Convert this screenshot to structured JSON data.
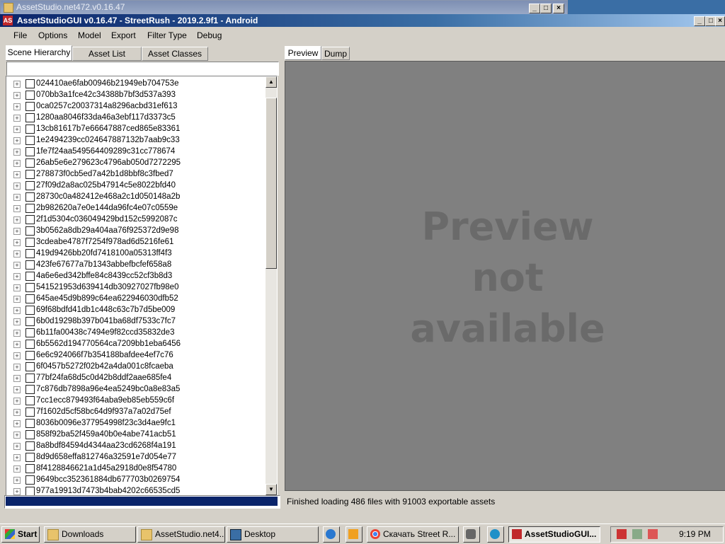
{
  "background_window": {
    "title": "AssetStudio.net472.v0.16.47"
  },
  "window": {
    "title": "AssetStudioGUI v0.16.47 - StreetRush - 2019.2.9f1 - Android",
    "logo": "AS"
  },
  "menu": [
    "File",
    "Options",
    "Model",
    "Export",
    "Filter Type",
    "Debug"
  ],
  "left_tabs": [
    "Scene Hierarchy",
    "Asset List",
    "Asset Classes"
  ],
  "search": {
    "value": ""
  },
  "tree_items": [
    "024410ae6fab00946b21949eb704753e",
    "070bb3a1fce42c34388b7bf3d537a393",
    "0ca0257c20037314a8296acbd31ef613",
    "1280aa8046f33da46a3ebf117d3373c5",
    "13cb81617b7e66647887ced865e83361",
    "1e2494239cc024647887132b7aab9c33",
    "1fe7f24aa549564409289c31cc778674",
    "26ab5e6e279623c4796ab050d7272295",
    "278873f0cb5ed7a42b1d8bbf8c3fbed7",
    "27f09d2a8ac025b47914c5e8022bfd40",
    "28730c0a482412e468a2c1d050148a2b",
    "2b982620a7e0e144da96fc4e07c0559e",
    "2f1d5304c036049429bd152c5992087c",
    "3b0562a8db29a404aa76f925372d9e98",
    "3cdeabe4787f7254f978ad6d5216fe61",
    "419d9426bb20fd7418100a05313ff4f3",
    "423fe67677a7b1343abbefbcfef658a8",
    "4a6e6ed342bffe84c8439cc52cf3b8d3",
    "541521953d639414db30927027fb98e0",
    "645ae45d9b899c64ea622946030dfb52",
    "69f68bdfd41db1c448c63c7b7d5be009",
    "6b0d19298b397b041ba68df7533c7fc7",
    "6b11fa00438c7494e9f82ccd35832de3",
    "6b5562d194770564ca7209bb1eba6456",
    "6e6c924066f7b354188bafdee4ef7c76",
    "6f0457b5272f02b42a4da001c8fcaeba",
    "77bf24fa68d5c0d42b8ddf2aae685fe4",
    "7c876db7898a96e4ea5249bc0a8e83a5",
    "7cc1ecc879493f64aba9eb85eb559c6f",
    "7f1602d5cf58bc64d9f937a7a02d75ef",
    "8036b0096e377954998f23c3d4ae9fc1",
    "858f92ba52f459a40b0e4abe741acb51",
    "8a8bdf84594d4344aa23cd6268f4a191",
    "8d9d658effa812746a32591e7d054e77",
    "8f4128846621a1d45a2918d0e8f54780",
    "9649bcc352361884db677703b0269754",
    "977a19913d7473b4bab4202c66535cd5"
  ],
  "tree_progress": 1.0,
  "right_tabs": [
    "Preview",
    "Dump"
  ],
  "preview_message": [
    "Preview",
    "not",
    "available"
  ],
  "status": "Finished loading 486 files with 91003 exportable assets",
  "taskbar": {
    "start": "Start",
    "items": [
      "Downloads",
      "AssetStudio.net4...",
      "Desktop",
      "Скачать Street R...",
      "AssetStudioGUI..."
    ],
    "clock": "9:19 PM"
  },
  "colors": {
    "titlebar": "#0a246a",
    "desktop": "#3a6ea5",
    "preview_bg": "#808080",
    "logo": "#c0282b"
  }
}
